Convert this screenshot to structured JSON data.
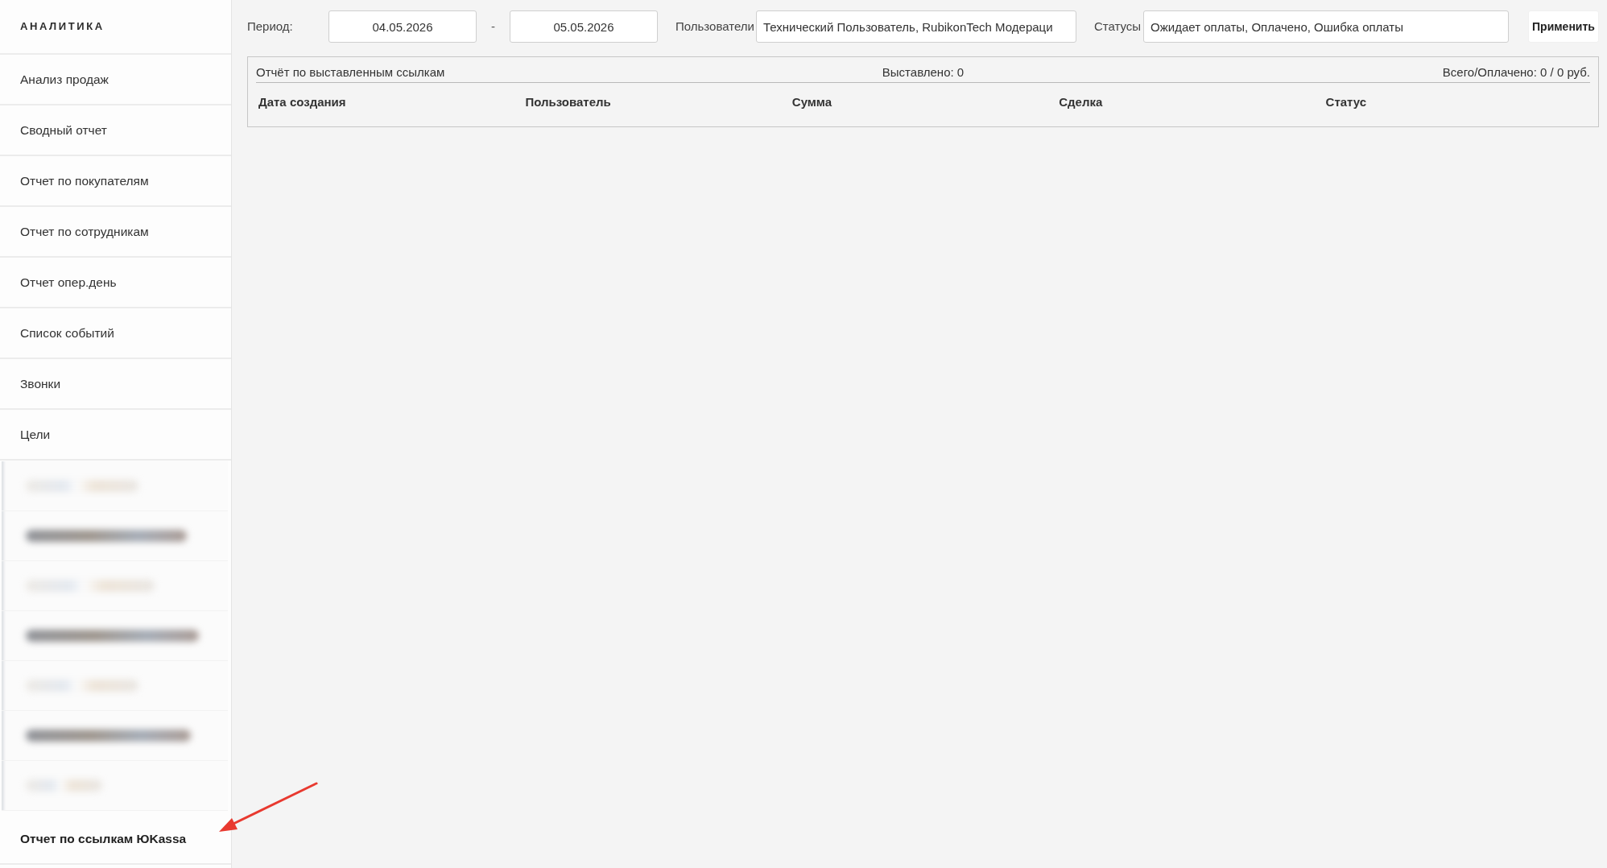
{
  "sidebar": {
    "title": "АНАЛИТИКА",
    "items": [
      {
        "kind": "link",
        "label": "Анализ продаж",
        "selected": false
      },
      {
        "kind": "link",
        "label": "Сводный отчет",
        "selected": false
      },
      {
        "kind": "link",
        "label": "Отчет по покупателям",
        "selected": false
      },
      {
        "kind": "link",
        "label": "Отчет по сотрудникам",
        "selected": false
      },
      {
        "kind": "link",
        "label": "Отчет опер.день",
        "selected": false
      },
      {
        "kind": "link",
        "label": "Список событий",
        "selected": false
      },
      {
        "kind": "link",
        "label": "Звонки",
        "selected": false
      },
      {
        "kind": "link",
        "label": "Цели",
        "selected": false
      },
      {
        "kind": "blurred"
      },
      {
        "kind": "blurred"
      },
      {
        "kind": "blurred"
      },
      {
        "kind": "blurred"
      },
      {
        "kind": "blurred"
      },
      {
        "kind": "blurred"
      },
      {
        "kind": "blurred"
      },
      {
        "kind": "link",
        "label": "Отчет по ссылкам ЮKassa",
        "selected": true
      }
    ]
  },
  "filters": {
    "period_label": "Период:",
    "date_from": "04.05.2026",
    "separator": "-",
    "date_to": "05.05.2026",
    "users_label": "Пользователи",
    "users_value": "Технический Пользователь, RubikonTech Модераци",
    "statuses_label": "Статусы",
    "statuses_value": "Ожидает оплаты, Оплачено, Ошибка оплаты",
    "apply_button": "Применить"
  },
  "report": {
    "title": "Отчёт по выставленным ссылкам",
    "issued": "Выставлено: 0",
    "totals": "Всего/Оплачено: 0 / 0 руб.",
    "columns": [
      "Дата создания",
      "Пользователь",
      "Сумма",
      "Сделка",
      "Статус"
    ]
  },
  "annotations": [
    {
      "kind": "arrow"
    }
  ]
}
